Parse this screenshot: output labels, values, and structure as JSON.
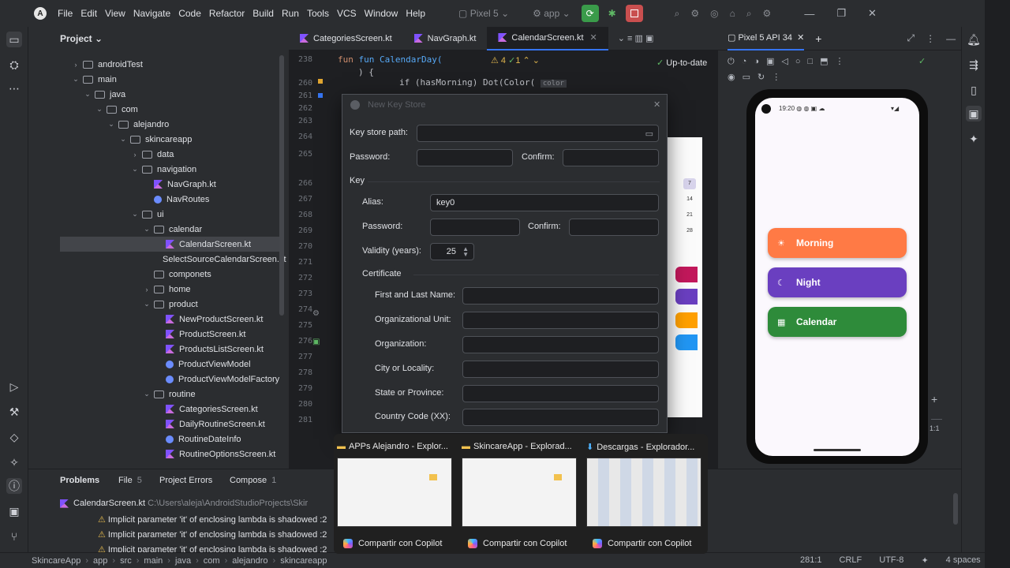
{
  "menu": [
    "File",
    "Edit",
    "View",
    "Navigate",
    "Code",
    "Refactor",
    "Build",
    "Run",
    "Tools",
    "VCS",
    "Window",
    "Help"
  ],
  "toolbar": {
    "device": "Pixel 5",
    "config": "app"
  },
  "project": {
    "header": "Project",
    "tree": [
      {
        "label": "androidTest",
        "indent": 1,
        "kind": "folder",
        "chev": "›"
      },
      {
        "label": "main",
        "indent": 1,
        "kind": "folder",
        "chev": "⌄"
      },
      {
        "label": "java",
        "indent": 2,
        "kind": "folder",
        "chev": "⌄"
      },
      {
        "label": "com",
        "indent": 3,
        "kind": "folder",
        "chev": "⌄"
      },
      {
        "label": "alejandro",
        "indent": 4,
        "kind": "folder",
        "chev": "⌄"
      },
      {
        "label": "skincareapp",
        "indent": 5,
        "kind": "folder",
        "chev": "⌄"
      },
      {
        "label": "data",
        "indent": 6,
        "kind": "folder",
        "chev": "›"
      },
      {
        "label": "navigation",
        "indent": 6,
        "kind": "folder",
        "chev": "⌄"
      },
      {
        "label": "NavGraph.kt",
        "indent": 7,
        "kind": "kt",
        "chev": ""
      },
      {
        "label": "NavRoutes",
        "indent": 7,
        "kind": "kto",
        "chev": ""
      },
      {
        "label": "ui",
        "indent": 6,
        "kind": "folder",
        "chev": "⌄"
      },
      {
        "label": "calendar",
        "indent": 7,
        "kind": "folder",
        "chev": "⌄"
      },
      {
        "label": "CalendarScreen.kt",
        "indent": 8,
        "kind": "kt",
        "chev": "",
        "selected": true
      },
      {
        "label": "SelectSourceCalendarScreen.kt",
        "indent": 8,
        "kind": "kt",
        "chev": ""
      },
      {
        "label": "componets",
        "indent": 7,
        "kind": "folder",
        "chev": ""
      },
      {
        "label": "home",
        "indent": 7,
        "kind": "folder",
        "chev": "›"
      },
      {
        "label": "product",
        "indent": 7,
        "kind": "folder",
        "chev": "⌄"
      },
      {
        "label": "NewProductScreen.kt",
        "indent": 8,
        "kind": "kt",
        "chev": ""
      },
      {
        "label": "ProductScreen.kt",
        "indent": 8,
        "kind": "kt",
        "chev": ""
      },
      {
        "label": "ProductsListScreen.kt",
        "indent": 8,
        "kind": "kt",
        "chev": ""
      },
      {
        "label": "ProductViewModel",
        "indent": 8,
        "kind": "kto",
        "chev": ""
      },
      {
        "label": "ProductViewModelFactory",
        "indent": 8,
        "kind": "kto",
        "chev": ""
      },
      {
        "label": "routine",
        "indent": 7,
        "kind": "folder",
        "chev": "⌄"
      },
      {
        "label": "CategoriesScreen.kt",
        "indent": 8,
        "kind": "kt",
        "chev": ""
      },
      {
        "label": "DailyRoutineScreen.kt",
        "indent": 8,
        "kind": "kt",
        "chev": ""
      },
      {
        "label": "RoutineDateInfo",
        "indent": 8,
        "kind": "kto",
        "chev": ""
      },
      {
        "label": "RoutineOptionsScreen.kt",
        "indent": 8,
        "kind": "kt",
        "chev": ""
      }
    ]
  },
  "editor": {
    "tabs": [
      "CategoriesScreen.kt",
      "NavGraph.kt",
      "CalendarScreen.kt"
    ],
    "active_tab": 2,
    "warnings": "4",
    "checks": "1",
    "status": "Up-to-date",
    "line_numbers": [
      "238",
      "260",
      "261",
      "262",
      "263",
      "264",
      "265",
      "266",
      "267",
      "268",
      "269",
      "270",
      "271",
      "272",
      "273",
      "274",
      "275",
      "276",
      "277",
      "278",
      "279",
      "280",
      "281"
    ],
    "code_line_1": "fun CalendarDay(",
    "code_line_2": ") {",
    "code_line_3": "if (hasMorning) Dot(Color(",
    "code_hint": "color"
  },
  "device": {
    "tab": "Pixel 5 API 34",
    "time": "19:20",
    "buttons": [
      {
        "label": "Morning",
        "color": "#ff7a45"
      },
      {
        "label": "Night",
        "color": "#6a3fc0"
      },
      {
        "label": "Calendar",
        "color": "#2e8b3a"
      }
    ],
    "calendar_days": [
      "7",
      "14",
      "21",
      "28"
    ],
    "zoom_label": "1:1"
  },
  "dialog": {
    "title": "New Key Store",
    "key_store_path_label": "Key store path:",
    "password_label": "Password:",
    "confirm_label": "Confirm:",
    "key_section": "Key",
    "alias_label": "Alias:",
    "alias_value": "key0",
    "key_password_label": "Password:",
    "key_confirm_label": "Confirm:",
    "validity_label": "Validity (years):",
    "validity_value": "25",
    "certificate_section": "Certificate",
    "first_last_label": "First and Last Name:",
    "org_unit_label": "Organizational Unit:",
    "org_label": "Organization:",
    "city_label": "City or Locality:",
    "state_label": "State or Province:",
    "country_label": "Country Code (XX):"
  },
  "problems": {
    "tabs": [
      {
        "label": "Problems",
        "count": ""
      },
      {
        "label": "File",
        "count": "5"
      },
      {
        "label": "Project Errors",
        "count": ""
      },
      {
        "label": "Compose",
        "count": "1"
      }
    ],
    "file_row": "CalendarScreen.kt",
    "file_path": "C:\\Users\\aleja\\AndroidStudioProjects\\Skir",
    "items": [
      "Implicit parameter 'it' of enclosing lambda is shadowed :2",
      "Implicit parameter 'it' of enclosing lambda is shadowed :2",
      "Implicit parameter 'it' of enclosing lambda is shadowed :2"
    ]
  },
  "previews": [
    {
      "title": "APPs Alejandro - Explor...",
      "action": "Compartir con Copilot"
    },
    {
      "title": "SkincareApp - Explorad...",
      "action": "Compartir con Copilot"
    },
    {
      "title": "Descargas - Explorador...",
      "action": "Compartir con Copilot"
    }
  ],
  "statusbar": {
    "breadcrumbs": [
      "SkincareApp",
      "app",
      "src",
      "main",
      "java",
      "com",
      "alejandro",
      "skincareapp"
    ],
    "position": "281:1",
    "line_sep": "CRLF",
    "encoding": "UTF-8",
    "indent": "4 spaces"
  }
}
